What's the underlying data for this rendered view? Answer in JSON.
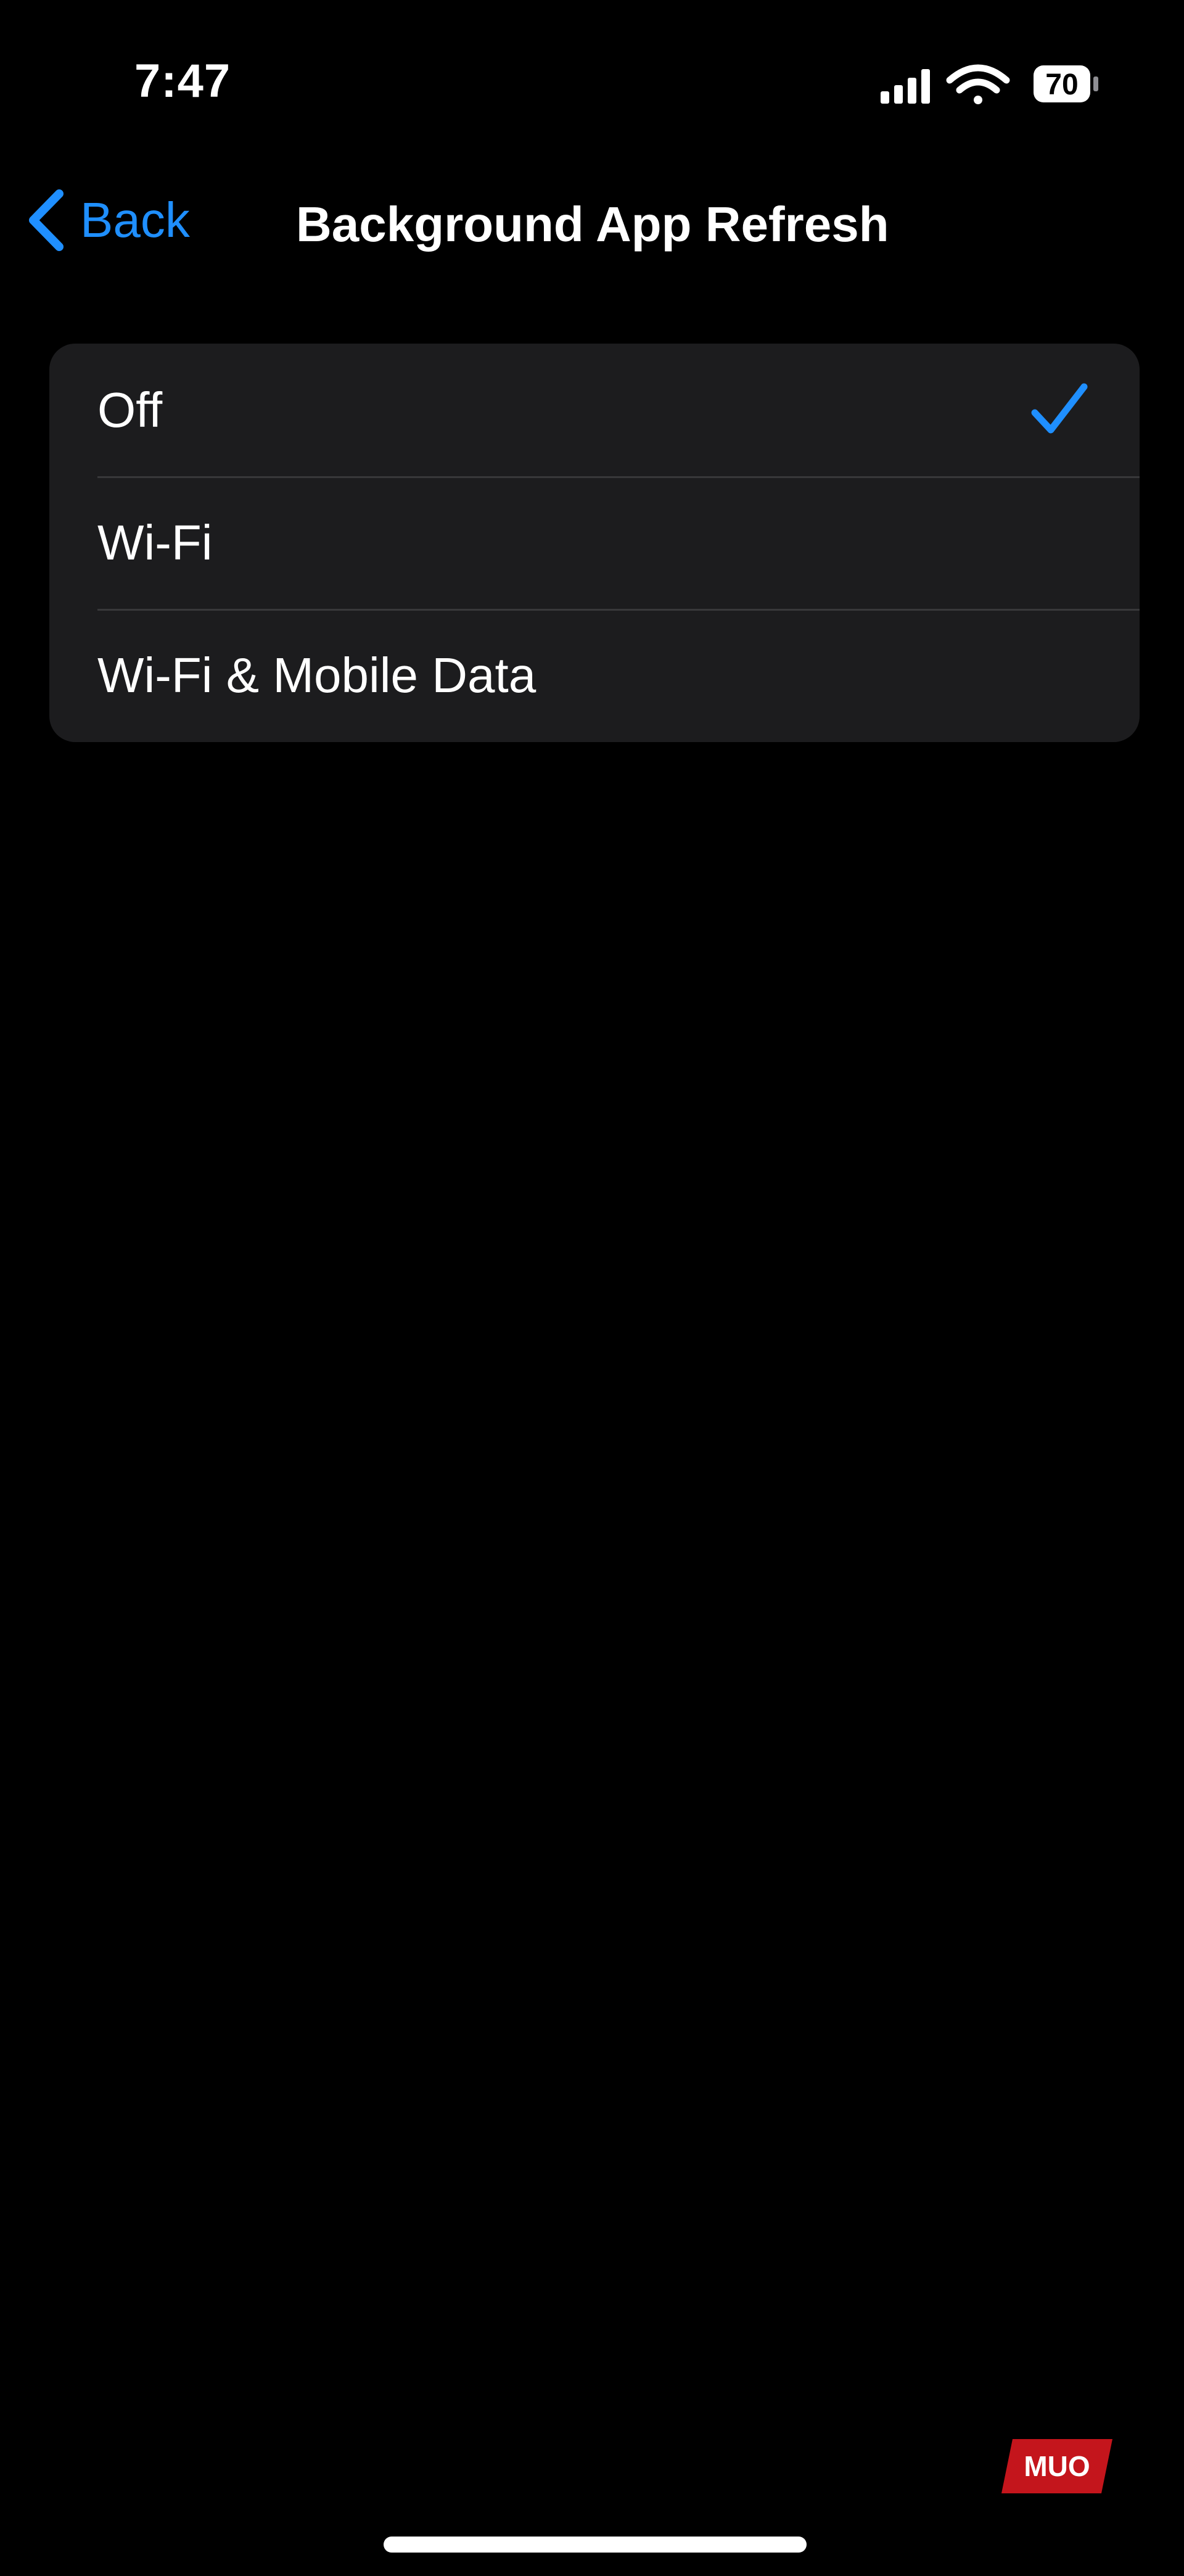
{
  "status_bar": {
    "time": "7:47",
    "battery_level": "70",
    "icons": [
      "cellular-signal-icon",
      "wifi-icon",
      "battery-icon"
    ]
  },
  "nav": {
    "back_label": "Back",
    "title": "Background App Refresh"
  },
  "options": [
    {
      "label": "Off",
      "selected": true
    },
    {
      "label": "Wi-Fi",
      "selected": false
    },
    {
      "label": "Wi-Fi & Mobile Data",
      "selected": false
    }
  ],
  "watermark": {
    "text": "MUO"
  },
  "colors": {
    "accent": "#1f8fff",
    "background": "#000000",
    "group_background": "#1c1c1e",
    "separator": "#38383a",
    "watermark": "#c4151c"
  }
}
